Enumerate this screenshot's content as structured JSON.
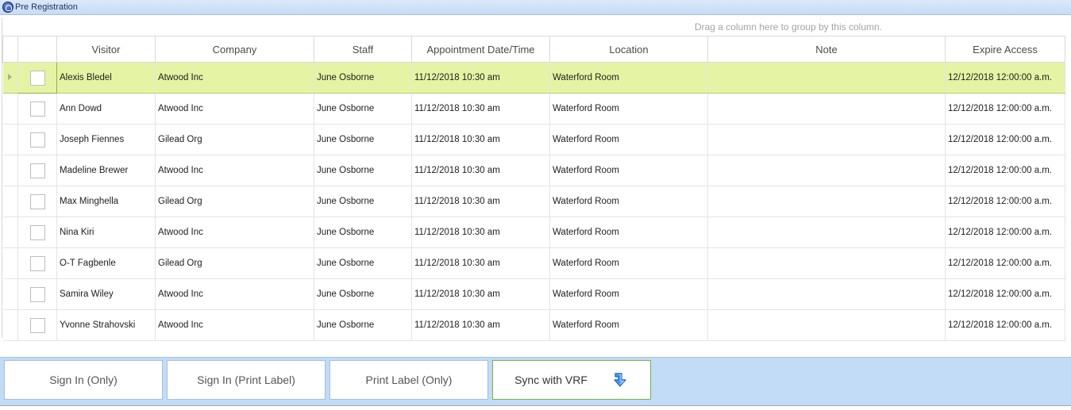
{
  "window": {
    "title": "Pre Registration"
  },
  "grid": {
    "group_hint": "Drag a column here to group by this column.",
    "columns": [
      "Visitor",
      "Company",
      "Staff",
      "Appointment Date/Time",
      "Location",
      "Note",
      "Expire Access"
    ],
    "rows": [
      {
        "visitor": "Alexis Bledel",
        "company": "Atwood Inc",
        "staff": "June Osborne",
        "appointment": "11/12/2018 10:30 am",
        "location": "Waterford Room",
        "note": "",
        "expire": "12/12/2018 12:00:00 a.m.",
        "selected": true
      },
      {
        "visitor": "Ann Dowd",
        "company": "Atwood Inc",
        "staff": "June Osborne",
        "appointment": "11/12/2018 10:30 am",
        "location": "Waterford Room",
        "note": "",
        "expire": "12/12/2018 12:00:00 a.m.",
        "selected": false
      },
      {
        "visitor": "Joseph Fiennes",
        "company": "Gilead Org",
        "staff": "June Osborne",
        "appointment": "11/12/2018 10:30 am",
        "location": "Waterford Room",
        "note": "",
        "expire": "12/12/2018 12:00:00 a.m.",
        "selected": false
      },
      {
        "visitor": "Madeline Brewer",
        "company": "Atwood Inc",
        "staff": "June Osborne",
        "appointment": "11/12/2018 10:30 am",
        "location": "Waterford Room",
        "note": "",
        "expire": "12/12/2018 12:00:00 a.m.",
        "selected": false
      },
      {
        "visitor": "Max Minghella",
        "company": "Gilead Org",
        "staff": "June Osborne",
        "appointment": "11/12/2018 10:30 am",
        "location": "Waterford Room",
        "note": "",
        "expire": "12/12/2018 12:00:00 a.m.",
        "selected": false
      },
      {
        "visitor": "Nina Kiri",
        "company": "Atwood Inc",
        "staff": "June Osborne",
        "appointment": "11/12/2018 10:30 am",
        "location": "Waterford Room",
        "note": "",
        "expire": "12/12/2018 12:00:00 a.m.",
        "selected": false
      },
      {
        "visitor": "O-T Fagbenle",
        "company": "Gilead Org",
        "staff": "June Osborne",
        "appointment": "11/12/2018 10:30 am",
        "location": "Waterford Room",
        "note": "",
        "expire": "12/12/2018 12:00:00 a.m.",
        "selected": false
      },
      {
        "visitor": "Samira Wiley",
        "company": "Atwood Inc",
        "staff": "June Osborne",
        "appointment": "11/12/2018 10:30 am",
        "location": "Waterford Room",
        "note": "",
        "expire": "12/12/2018 12:00:00 a.m.",
        "selected": false
      },
      {
        "visitor": "Yvonne Strahovski",
        "company": "Atwood Inc",
        "staff": "June Osborne",
        "appointment": "11/12/2018 10:30 am",
        "location": "Waterford Room",
        "note": "",
        "expire": "12/12/2018 12:00:00 a.m.",
        "selected": false
      }
    ]
  },
  "buttons": {
    "sign_in_only": "Sign In (Only)",
    "sign_in_print_label": "Sign In (Print Label)",
    "print_label_only": "Print Label (Only)",
    "sync_vrf": "Sync with VRF",
    "sync_icon": "sync-arrow-icon"
  },
  "colors": {
    "selected_row": "#e5f3a4",
    "button_bar": "#c2dbf7",
    "sync_border": "#77b33f",
    "sync_arrow": "#2f7fe0"
  }
}
